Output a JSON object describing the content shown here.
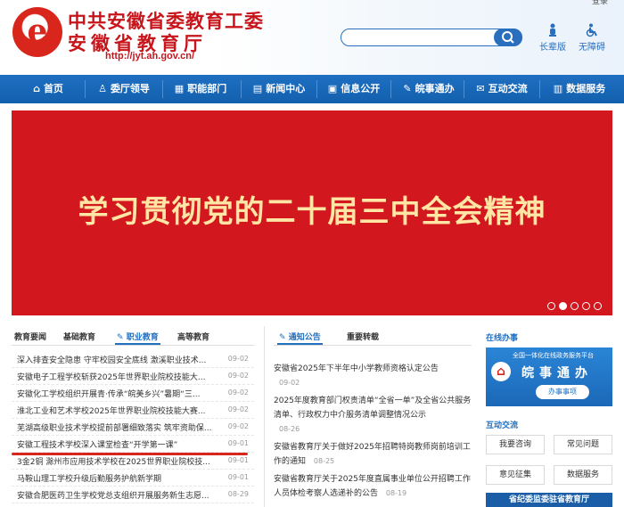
{
  "header": {
    "title_line1": "中共安徽省委教育工委",
    "title_line2": "安徽省教育厅",
    "url": "http://jyt.ah.gov.cn/",
    "login": "登录",
    "search_placeholder": "",
    "tools": [
      {
        "icon": "elder-icon",
        "label": "长辈版"
      },
      {
        "icon": "accessibility-icon",
        "label": "无障碍"
      }
    ]
  },
  "nav": {
    "items": [
      {
        "icon": "home-icon",
        "label": "首页"
      },
      {
        "icon": "leaders-icon",
        "label": "委厅领导"
      },
      {
        "icon": "departments-icon",
        "label": "职能部门"
      },
      {
        "icon": "news-icon",
        "label": "新闻中心"
      },
      {
        "icon": "info-icon",
        "label": "信息公开"
      },
      {
        "icon": "service-icon",
        "label": "皖事通办"
      },
      {
        "icon": "interaction-icon",
        "label": "互动交流"
      },
      {
        "icon": "data-icon",
        "label": "数据服务"
      }
    ]
  },
  "banner": {
    "text": "学习贯彻党的二十届三中全会精神",
    "dots": 5,
    "active_dot": 1
  },
  "news_tabs": [
    "教育要闻",
    "基础教育",
    "职业教育",
    "高等教育"
  ],
  "news_active_tab": 2,
  "news": [
    {
      "title": "深入排查安全隐患 守牢校园安全底线 激溪职业技术...",
      "date": "09-02"
    },
    {
      "title": "安徽电子工程学校斩获2025年世界职业院校技能大...",
      "date": "09-02"
    },
    {
      "title": "安徽化工学校组织开展青·传承“皖美乡兴”暑期“三...",
      "date": "09-02"
    },
    {
      "title": "淮北工业和艺术学校2025年世界职业院校技能大赛...",
      "date": "09-02"
    },
    {
      "title": "芜湖高级职业技术学校提前部署细致落实 筑牢资助保...",
      "date": "09-02"
    },
    {
      "title": "安徽工程技术学校深入课堂检查“开学第一课”",
      "date": "09-01"
    },
    {
      "title": "3金2铜 滁州市应用技术学校在2025世界职业院校技...",
      "date": "09-01"
    },
    {
      "title": "马鞍山理工学校升级后勤服务护航新学期",
      "date": "09-01"
    },
    {
      "title": "安徽合肥医药卫生学校党总支组织开展服务新生志愿...",
      "date": "08-29"
    }
  ],
  "notice_tabs": [
    "通知公告",
    "重要转载"
  ],
  "notices": [
    {
      "title": "安徽省2025年下半年中小学教师资格认定公告",
      "date": "09-02"
    },
    {
      "title": "2025年度教育部门权责清单“全省一单”及全省公共服务清单、行政权力中介服务清单调整情况公示",
      "date": "08-26"
    },
    {
      "title": "安徽省教育厅关于做好2025年招聘特岗教师岗前培训工作的通知",
      "date": "08-25"
    },
    {
      "title": "安徽省教育厅关于2025年度直属事业单位公开招聘工作人员体检考察人选递补的公告",
      "date": "08-19"
    }
  ],
  "online": {
    "title": "在线办事",
    "platform": "全国一体化在线政务服务平台",
    "brand": "皖事通办",
    "button": "办事事项"
  },
  "interaction": {
    "title": "互动交流",
    "buttons": [
      "我要咨询",
      "常见问题",
      "意见征集",
      "数据服务"
    ]
  },
  "footer_banner": "省纪委监委驻省教育厅",
  "colors": {
    "primary": "#1f6fc2",
    "brand_red": "#c8151b",
    "banner_red": "#d3171f",
    "banner_text": "#ffe6a4"
  }
}
